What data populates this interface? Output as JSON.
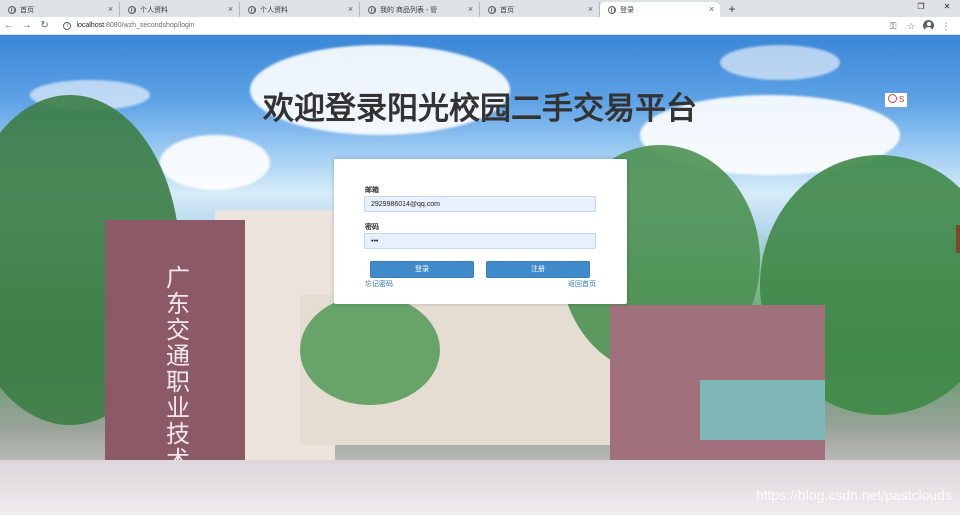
{
  "browser": {
    "tabs": [
      {
        "title": "首页",
        "active": false
      },
      {
        "title": "个人资料",
        "active": false
      },
      {
        "title": "个人资料",
        "active": false
      },
      {
        "title": "我的 商品列表 - 管",
        "active": false
      },
      {
        "title": "首页",
        "active": false
      },
      {
        "title": "登录",
        "active": true
      }
    ],
    "new_tab_label": "+",
    "address": {
      "host": "localhost",
      "path": ":8080/wzh_secondshop/login"
    }
  },
  "page": {
    "title": "欢迎登录阳光校园二手交易平台",
    "gate_text": "广东交通职业技术学院",
    "watermark": "https://blog.csdn.net/pastclouds",
    "side_tab_label": "S"
  },
  "login": {
    "email_label": "邮箱",
    "email_value": "2929986014@qq.com",
    "password_label": "密码",
    "password_value": "•••",
    "login_button": "登录",
    "register_button": "注册",
    "forgot_link": "忘记密码",
    "home_link": "返回首页"
  }
}
